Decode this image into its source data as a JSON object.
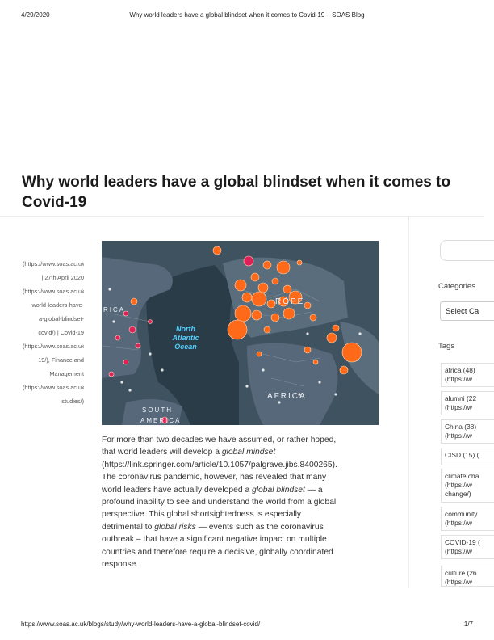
{
  "print_header": {
    "date": "4/29/2020",
    "title": "Why world leaders have a global blindset when it comes to Covid-19 – SOAS Blog"
  },
  "article": {
    "title_lines": [
      "Why world leaders have a global blindset when it comes to",
      "Covid-19"
    ],
    "meta_lines": [
      "(https://www.soas.ac.uk/bl",
      "| 27th April 2020",
      "(https://www.soas.ac.uk/bl",
      "world-leaders-have-",
      "a-global-blindset-",
      "covid/) | Covid-19",
      "(https://www.soas.ac.uk/bl",
      "19/), Finance and",
      "Management",
      "(https://www.soas.ac.uk/bl",
      "studies/)"
    ],
    "map_labels": {
      "ocean_line1": "North",
      "ocean_line2": "Atlantic",
      "ocean_line3": "Ocean",
      "europe": "ROPE",
      "africa": "AFRICA",
      "south": "SOUTH",
      "america": "AMERICA",
      "rica": "RICA"
    },
    "body_lines": [
      [
        "For more than two decades we have assumed, or rather hoped,",
        ""
      ],
      [
        "that world leaders will develop a ",
        "global mindset"
      ],
      [
        "(https://link.springer.com/article/10.1057/palgrave.jibs.8400265).",
        ""
      ],
      [
        "The coronavirus pandemic, however, has revealed that many",
        ""
      ],
      [
        "world leaders have actually developed a ",
        "global blindset",
        " — a"
      ],
      [
        "profound inability to see and understand the world from a global",
        ""
      ],
      [
        "perspective. This global shortsightedness is especially",
        ""
      ],
      [
        "detrimental to ",
        "global risks",
        " — events such as the coronavirus"
      ],
      [
        "outbreak –  that have a significant negative impact on multiple",
        ""
      ],
      [
        "countries and therefore require a decisive, globally coordinated",
        ""
      ],
      [
        "response.",
        ""
      ]
    ]
  },
  "sidebar": {
    "categories_heading": "Categories",
    "categories_select": "Select Ca",
    "tags_heading": "Tags",
    "tags": [
      [
        "africa (48)",
        "(https://w"
      ],
      [
        "alumni (22",
        "(https://w"
      ],
      [
        "China (38)",
        "(https://w"
      ],
      [
        "CISD (15) (",
        ""
      ],
      [
        "climate cha",
        "(https://w",
        "change/)"
      ],
      [
        "community",
        "(https://w"
      ],
      [
        "COVID-19 (",
        "(https://w"
      ],
      [
        "culture (26",
        "(https://w"
      ]
    ]
  },
  "print_footer": {
    "url": "https://www.soas.ac.uk/blogs/study/why-world-leaders-have-a-global-blindset-covid/",
    "page": "1/7"
  }
}
